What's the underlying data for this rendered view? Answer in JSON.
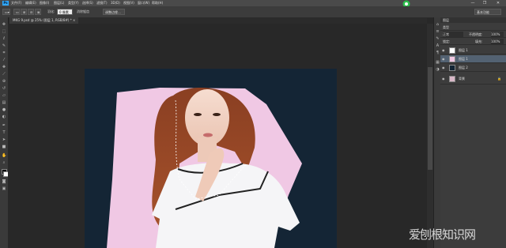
{
  "app": {
    "logo": "Ps"
  },
  "menu": [
    "文件(F)",
    "编辑(E)",
    "图像(I)",
    "图层(L)",
    "类型(Y)",
    "选择(S)",
    "滤镜(T)",
    "3D(D)",
    "视图(V)",
    "窗口(W)",
    "帮助(H)"
  ],
  "window_controls": {
    "minimize": "—",
    "restore": "❐",
    "close": "✕"
  },
  "options": {
    "feather_label": "羽化:",
    "feather_value": "0 像素",
    "antialias_label": "消除锯齿",
    "style_label": "调整边缘...",
    "essentials": "基本功能"
  },
  "document_tab": {
    "label": "MKG 9.psd @ 25% (图层 1, RGB/8#) * ×"
  },
  "layers_panel": {
    "title": "图层",
    "kind_label": "类型",
    "blend_mode": "正常",
    "opacity_label": "不透明度:",
    "opacity_value": "100%",
    "lock_label": "锁定:",
    "fill_label": "填充:",
    "fill_value": "100%",
    "layers": [
      {
        "name": "图层 1",
        "selected": false
      },
      {
        "name": "图层 1",
        "selected": true
      },
      {
        "name": "图层 2",
        "selected": false
      },
      {
        "name": "背景",
        "selected": false
      }
    ]
  },
  "watermark": {
    "text": "爱刨根知识网"
  },
  "colors": {
    "canvas_bg": "#142535",
    "accent_blue": "#31a8ff",
    "selection_pink": "#f0c8e4"
  },
  "icons": [
    "move-icon",
    "marquee-icon",
    "lasso-icon",
    "quick-select-icon",
    "crop-icon",
    "eyedropper-icon",
    "healing-icon",
    "brush-icon",
    "clone-icon",
    "history-brush-icon",
    "eraser-icon",
    "gradient-icon",
    "blur-icon",
    "dodge-icon",
    "pen-icon",
    "type-icon",
    "path-select-icon",
    "shape-icon",
    "hand-icon",
    "zoom-icon"
  ]
}
